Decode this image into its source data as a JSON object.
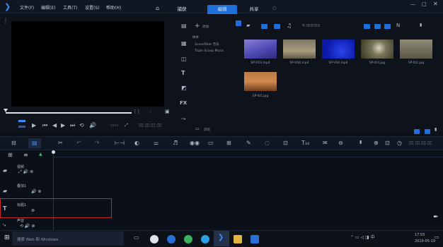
{
  "menu": {
    "file": "文件(F)",
    "edit": "编辑(E)",
    "tools": "工具(T)",
    "settings": "设置(S)",
    "help": "帮助(H)"
  },
  "tabs": {
    "capture": "捕获",
    "edit": "编辑",
    "share": "共享"
  },
  "library": {
    "add_label": "添加",
    "browse_label": "浏览",
    "folders": [
      "样本",
      "ScoreFitter 音乐",
      "Triple Scoop Music"
    ],
    "thumbnails": [
      {
        "label": "SP-V03.mp4",
        "color": "#5f5fb0"
      },
      {
        "label": "SP-V04.mp4",
        "color": "#8a8060"
      },
      {
        "label": "SP-V04.mp4",
        "color": "#1020b8"
      },
      {
        "label": "SP-I03.jpg",
        "color": "#5a5a40"
      },
      {
        "label": "SP-I02.jpg",
        "color": "#6a6656"
      },
      {
        "label": "SP-I01.jpg",
        "color": "#9a5a30"
      }
    ]
  },
  "tracks": {
    "video": "视频",
    "overlay": "叠加1",
    "title": "标题1",
    "voice": "声音"
  },
  "taskbar": {
    "search_placeholder": "搜索 Web 和 Windows",
    "time": "17:55",
    "date": "2019-05-19"
  },
  "colors": {
    "accent": "#1e6fd9",
    "highlight_box": "#c0282a"
  }
}
